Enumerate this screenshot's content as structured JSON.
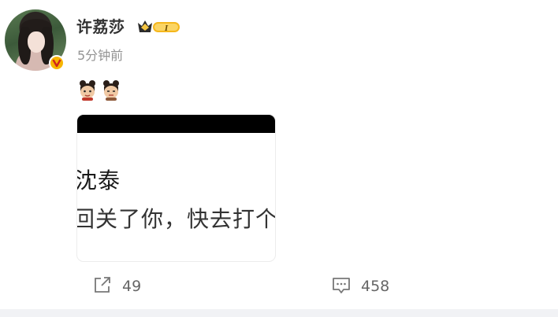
{
  "post": {
    "author": {
      "name": "许荔莎",
      "avatar_icon": "avatar-portrait",
      "verified_icon": "verified-v-icon",
      "vip_badge": {
        "icon": "crown-vip-icon",
        "level": "I",
        "color": "#f5b71c"
      }
    },
    "time": "5分钟前",
    "emojis": [
      "emoji-face-1",
      "emoji-face-2"
    ],
    "image": {
      "title": "沈泰",
      "subtitle": "回关了你，快去打个"
    },
    "actions": {
      "repost": {
        "icon": "repost-icon",
        "count": "49"
      },
      "comment": {
        "icon": "comment-icon",
        "count": "458"
      }
    }
  },
  "colors": {
    "name": "#333333",
    "time": "#939393",
    "count": "#666666",
    "verified": "#f7b500",
    "divider": "#f1f2f5"
  }
}
